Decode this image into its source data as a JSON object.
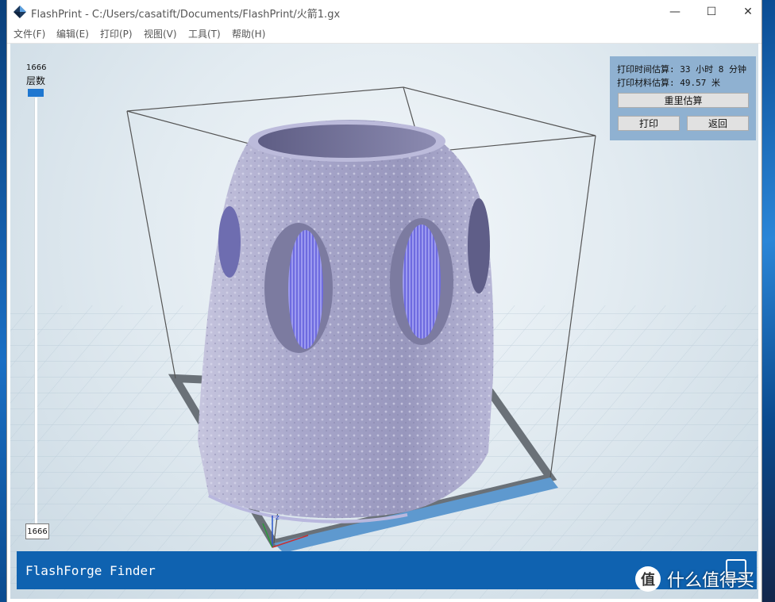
{
  "window": {
    "title": "FlashPrint - C:/Users/casatift/Documents/FlashPrint/火箭1.gx",
    "controls": {
      "minimize": "—",
      "maximize": "☐",
      "close": "✕"
    }
  },
  "menu": [
    {
      "label": "文件(F)"
    },
    {
      "label": "编辑(E)"
    },
    {
      "label": "打印(P)"
    },
    {
      "label": "视图(V)"
    },
    {
      "label": "工具(T)"
    },
    {
      "label": "帮助(H)"
    }
  ],
  "layer_slider": {
    "top_value": "1666",
    "label": "层数",
    "current_value": "1666"
  },
  "estimate": {
    "time_line": "打印时间估算: 33 小时 8 分钟",
    "material_line": "打印材料估算: 49.57 米",
    "reestimate_button": "重里估算",
    "print_button": "打印",
    "back_button": "返回"
  },
  "printer": {
    "name": "FlashForge Finder"
  },
  "watermark": {
    "badge": "值",
    "text": "什么值得买"
  },
  "colors": {
    "model": "#a9a8cc",
    "printer_bar": "#0f62b0",
    "panel": "#8fb1d1",
    "accent": "#1f77d0"
  }
}
